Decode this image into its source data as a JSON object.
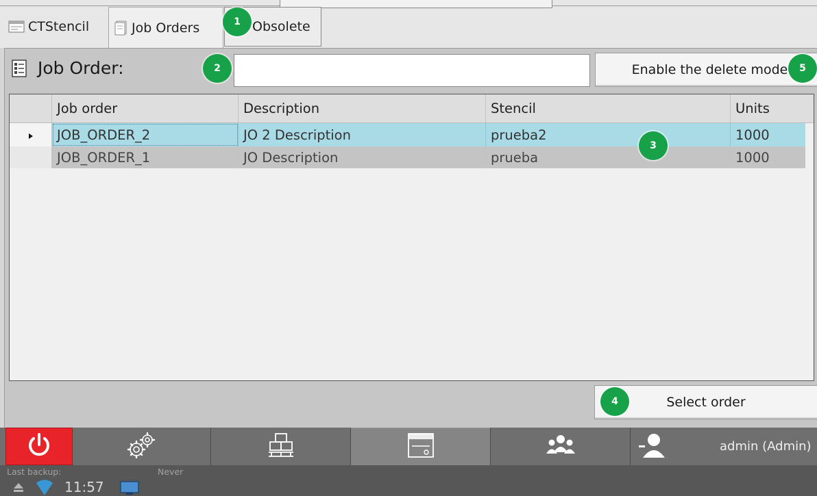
{
  "tabs": [
    {
      "label": "CTStencil",
      "icon": "stencil-icon"
    },
    {
      "label": "Job Orders",
      "icon": "document-icon",
      "active": true
    },
    {
      "label": "Obsolete"
    }
  ],
  "job_order": {
    "label": "Job Order:",
    "icon": "job-order-icon",
    "input_value": ""
  },
  "buttons": {
    "delete_mode": "Enable the delete mode",
    "select_order": "Select order"
  },
  "table": {
    "columns": [
      "Job order",
      "Description",
      "Stencil",
      "Units"
    ],
    "rows": [
      {
        "job_order": "JOB_ORDER_2",
        "description": "JO 2 Description",
        "stencil": "prueba2",
        "units": "1000",
        "selected": true
      },
      {
        "job_order": "JOB_ORDER_1",
        "description": "JO Description",
        "stencil": "prueba",
        "units": "1000"
      }
    ]
  },
  "badges": [
    "1",
    "2",
    "3",
    "4",
    "5"
  ],
  "nav": {
    "items": [
      "power-icon",
      "settings-gears-icon",
      "pallet-icon",
      "stencil-icon",
      "users-group-icon",
      "user-icon"
    ],
    "user_label": "admin (Admin)"
  },
  "status": {
    "last_backup_label": "Last backup:",
    "last_backup_value": "Never",
    "time": "11:57"
  },
  "colors": {
    "selected_row": "#a9dbe6",
    "alt_row": "#c4c4c4",
    "badge": "#17a24a",
    "power_button": "#e8242a",
    "nav_background": "#6f6f6f"
  }
}
